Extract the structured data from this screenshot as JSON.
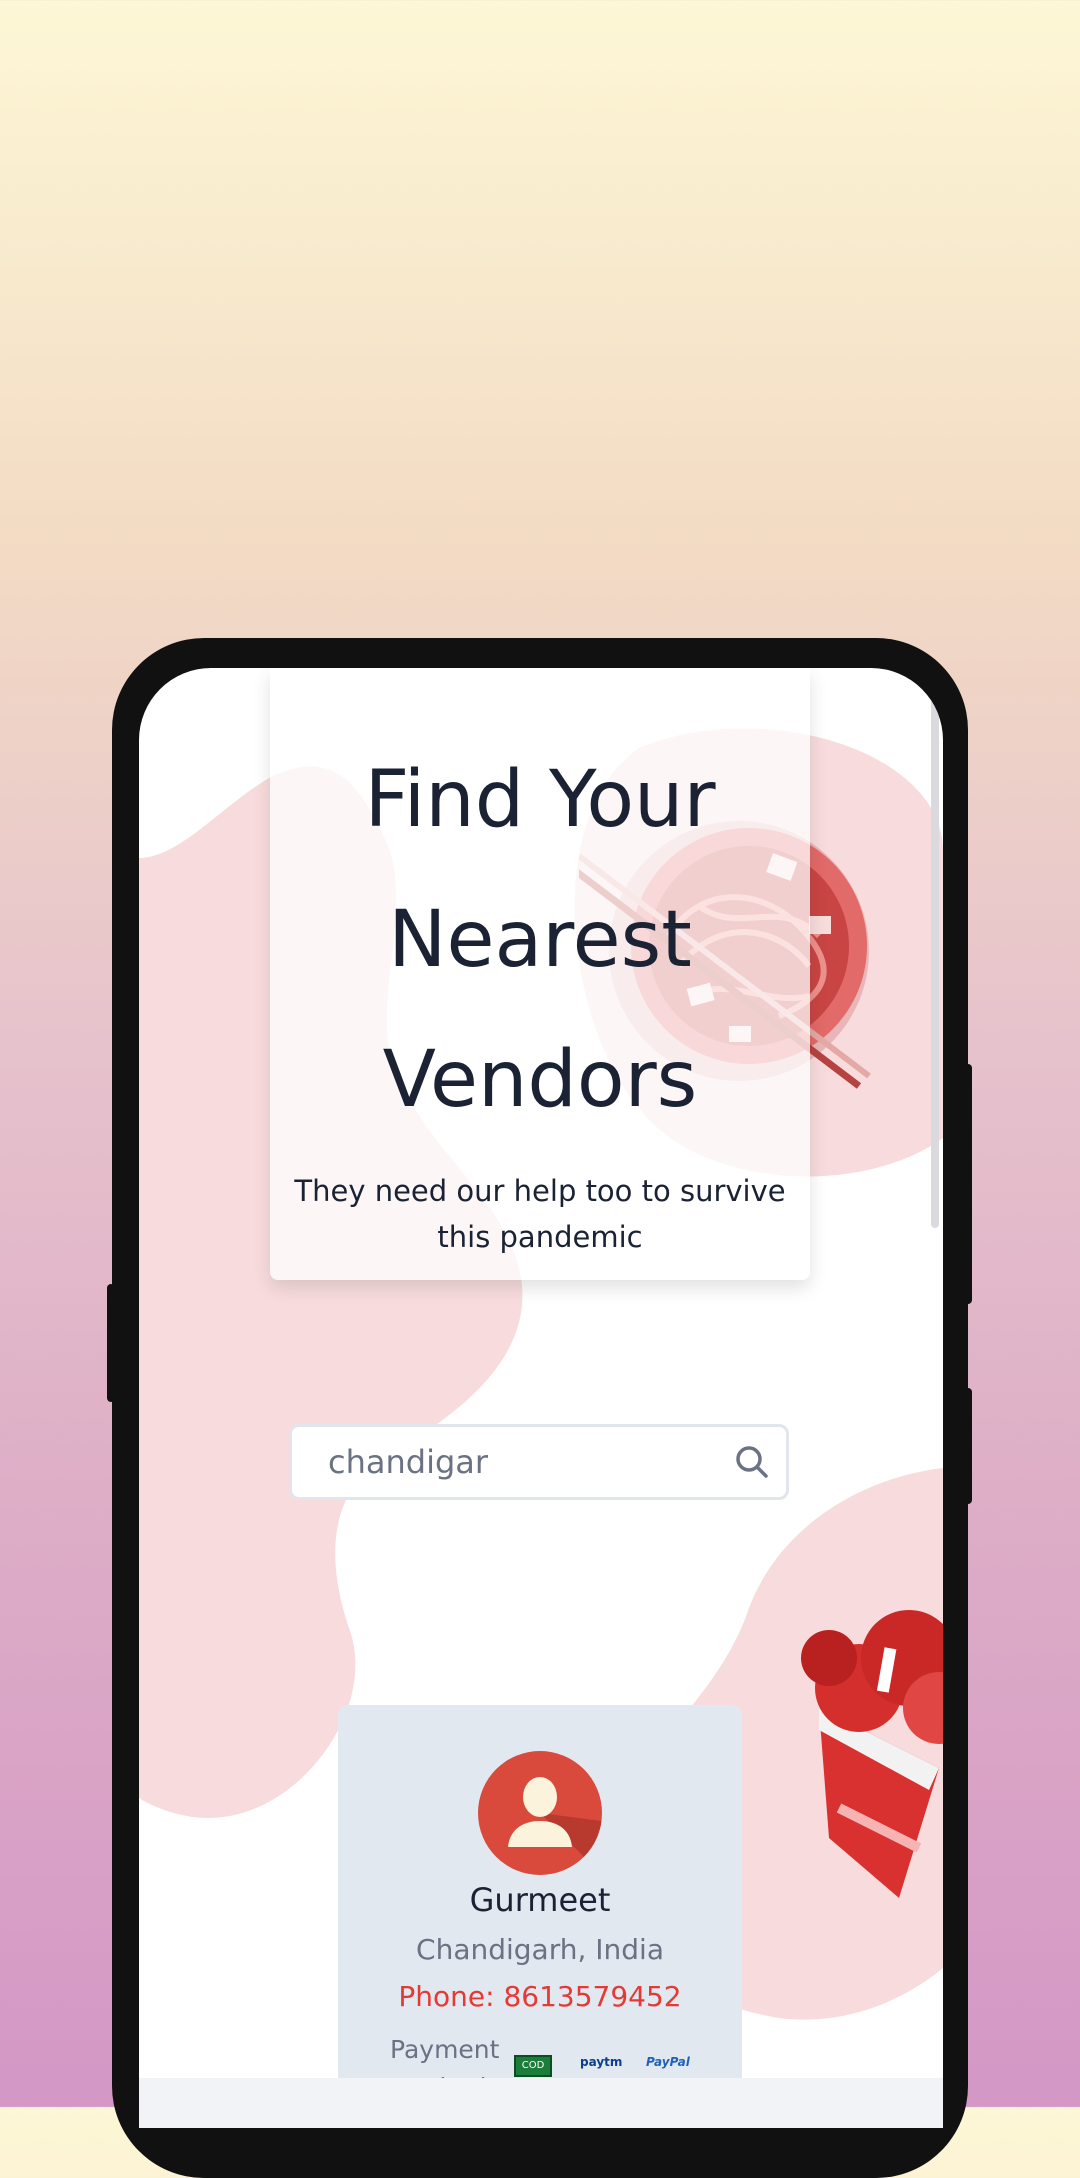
{
  "hero": {
    "title": "Find Your Nearest Vendors",
    "subtitle": "They need our help too to survive this pandemic"
  },
  "search": {
    "value": "chandigar",
    "icon": "search-icon"
  },
  "vendor": {
    "name": "Gurmeet",
    "location": "Chandigarh, India",
    "phone": "Phone: 8613579452",
    "payment_label": "Payment methods",
    "payment_methods": [
      "COD",
      "paytm",
      "PayPal"
    ]
  },
  "colors": {
    "accent_red": "#e53935",
    "blob_pink": "#f8dcdd",
    "card_gray": "#e2e8f0"
  }
}
